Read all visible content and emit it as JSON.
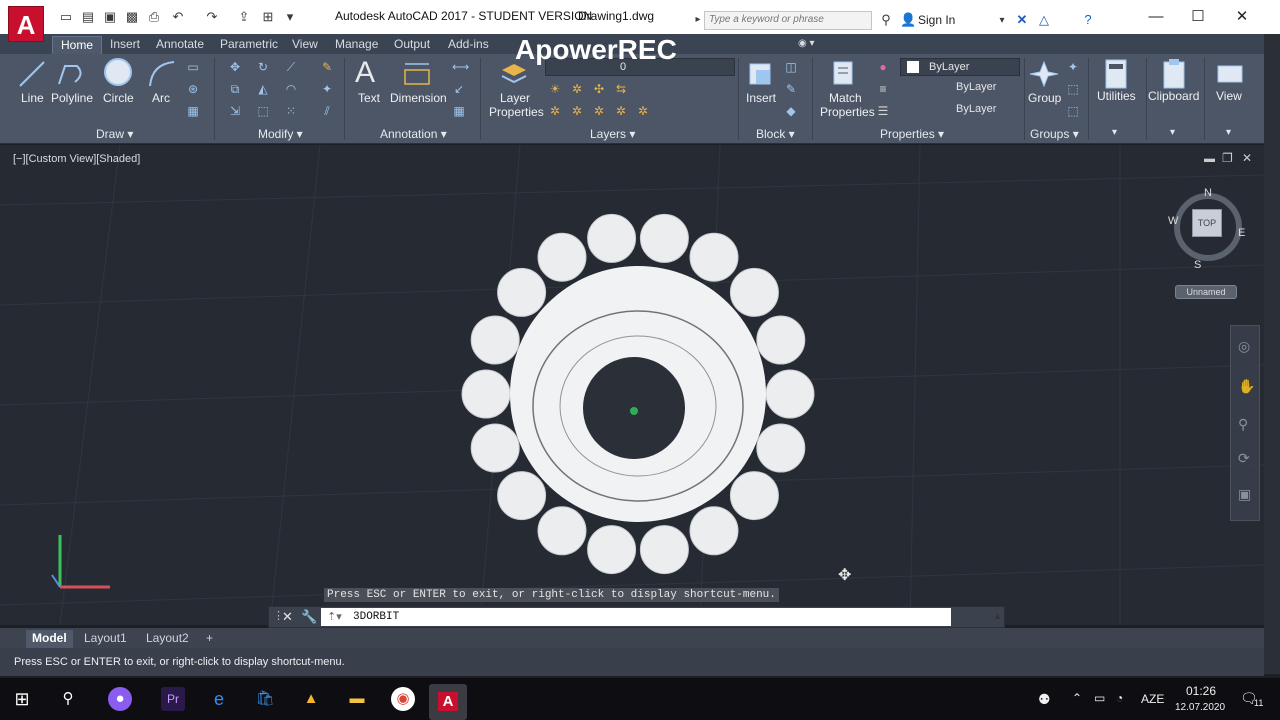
{
  "window": {
    "title": "Autodesk AutoCAD 2017 - STUDENT VERSION",
    "drawing": "Drawing1.dwg",
    "search_placeholder": "Type a keyword or phrase",
    "sign_in": "Sign In",
    "logo": "A"
  },
  "ribbon_tabs": [
    "Home",
    "Insert",
    "Annotate",
    "Parametric",
    "View",
    "Manage",
    "Output",
    "Add-ins"
  ],
  "ribbon": {
    "draw": {
      "line": "Line",
      "polyline": "Polyline",
      "circle": "Circle",
      "arc": "Arc",
      "panel": "Draw"
    },
    "modify": {
      "panel": "Modify"
    },
    "annotation": {
      "text": "Text",
      "dimension": "Dimension",
      "panel": "Annotation"
    },
    "layers": {
      "layer_properties_1": "Layer",
      "layer_properties_2": "Properties",
      "panel": "Layers",
      "current_layer": "0"
    },
    "block": {
      "insert": "Insert",
      "panel": "Block"
    },
    "properties": {
      "match_1": "Match",
      "match_2": "Properties",
      "color": "ByLayer",
      "linetype": "ByLayer",
      "lineweight": "ByLayer",
      "panel": "Properties"
    },
    "groups": {
      "group": "Group",
      "panel": "Groups"
    },
    "utilities": "Utilities",
    "clipboard": "Clipboard",
    "view": "View"
  },
  "viewport": {
    "label": "[−][Custom View][Shaded]",
    "viewcube": {
      "top": "TOP",
      "n": "N",
      "s": "S",
      "e": "E",
      "w": "W",
      "ucs": "Unnamed"
    }
  },
  "watermark": "ApowerREC",
  "command": {
    "hint": "Press ESC or ENTER to exit, or right-click to display shortcut-menu.",
    "current": "3DORBIT"
  },
  "layout_tabs": [
    "Model",
    "Layout1",
    "Layout2"
  ],
  "status_text": "Press ESC or ENTER to exit, or right-click to display shortcut-menu.",
  "taskbar": {
    "time": "01:26",
    "date": "12.07.2020",
    "lang": "AZE",
    "notif_count": "11"
  },
  "colors": {
    "accent": "#c8102e",
    "ribbon": "#4d5666",
    "viewport": "#262b33"
  }
}
